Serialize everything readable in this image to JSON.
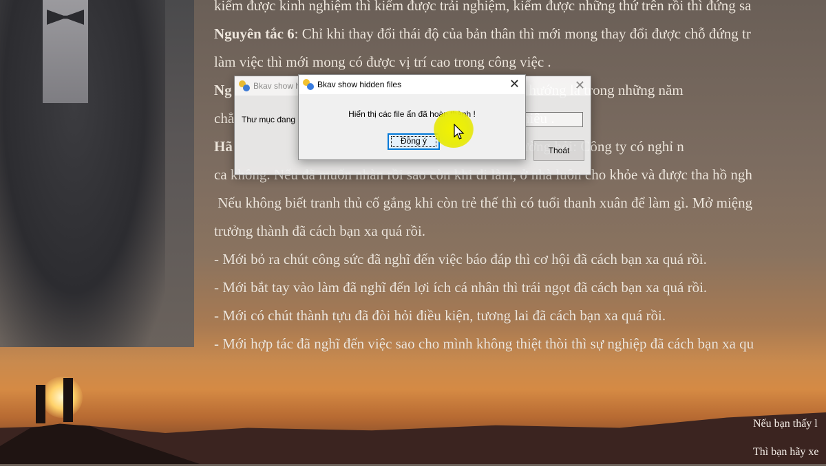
{
  "document": {
    "lines": [
      {
        "bold": "",
        "text": "kiếm được kinh nghiệm thì kiếm được trải nghiệm, kiếm được những thứ trên rồi thì đứng sa"
      },
      {
        "bold": "Nguyên tắc 6",
        "text": ": Chỉ khi thay đổi thái độ của bản thân thì mới mong thay đổi được chỗ đứng tr"
      },
      {
        "bold": "",
        "text": "làm việc thì mới mong có được vị trí cao trong công việc ."
      },
      {
        "bold": "Ng",
        "text": "                                                                     phương hướng là trong những năm"
      },
      {
        "bold": "",
        "text": "chẳ                                                                       bao nhiêu ."
      },
      {
        "bold": "Hã",
        "text": "                                                                     việc thường hỏi: Công ty có nghỉ n"
      },
      {
        "bold": "",
        "text": "ca không. Nếu đã muốn nhàn rồi sao còn khi đi làm, ở nhà luôn cho khỏe và được tha hồ ngh"
      },
      {
        "bold": "",
        "text": " Nếu không biết tranh thủ cố gắng khi còn trẻ thế thì có tuổi thanh xuân để làm gì. Mở miệng"
      },
      {
        "bold": "",
        "text": "trưởng thành đã cách bạn xa quá rồi."
      },
      {
        "bold": "",
        "text": "- Mới bỏ ra chút công sức đã nghĩ đến việc báo đáp thì cơ hội đã cách bạn xa quá rồi."
      },
      {
        "bold": "",
        "text": "- Mới bắt tay vào làm đã nghĩ đến lợi ích cá nhân thì trái ngọt đã cách bạn xa quá rồi."
      },
      {
        "bold": "",
        "text": "- Mới có chút thành tựu đã đòi hỏi điều kiện, tương lai đã cách bạn xa quá rồi."
      },
      {
        "bold": "",
        "text": "- Mới hợp tác đã nghĩ đến việc sao cho mình không thiệt thòi thì sự nghiệp đã cách bạn xa qu"
      }
    ],
    "bottom_lines": [
      "Nếu bạn thấy l",
      "Thì bạn hãy xe"
    ]
  },
  "back_dialog": {
    "title": "Bkav show hi",
    "close": "✕",
    "label": "Thư mục đang hiệ",
    "exit_button": "Thoát"
  },
  "front_dialog": {
    "title": "Bkav show hidden files",
    "close": "✕",
    "message": "Hiển thị các file ẩn đã hoàn thành !",
    "ok_button": "Đồng ý"
  },
  "colors": {
    "dialog_bg": "#f0f0f0",
    "focus_border": "#0078d7",
    "cursor_highlight": "#f3f300"
  }
}
